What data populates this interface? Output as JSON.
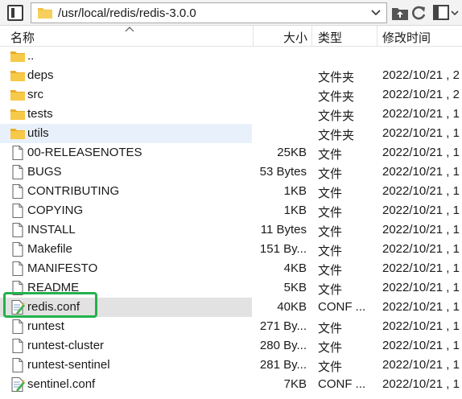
{
  "path": "/usr/local/redis/redis-3.0.0",
  "columns": {
    "name": "名称",
    "size": "大小",
    "type": "类型",
    "modified": "修改时间"
  },
  "colors": {
    "folder": "#f5c342",
    "highlight_light": "#e8f1fb",
    "highlight_selected": "#e2e2e2",
    "annotation_box": "#22b24c"
  },
  "rows": [
    {
      "name": "..",
      "size": "",
      "type": "",
      "modified": "",
      "icon": "folder-icon"
    },
    {
      "name": "deps",
      "size": "",
      "type": "文件夹",
      "modified": "2022/10/21 , 2",
      "icon": "folder-icon"
    },
    {
      "name": "src",
      "size": "",
      "type": "文件夹",
      "modified": "2022/10/21 , 2",
      "icon": "folder-icon"
    },
    {
      "name": "tests",
      "size": "",
      "type": "文件夹",
      "modified": "2022/10/21 , 1",
      "icon": "folder-icon"
    },
    {
      "name": "utils",
      "size": "",
      "type": "文件夹",
      "modified": "2022/10/21 , 1",
      "icon": "folder-icon"
    },
    {
      "name": "00-RELEASENOTES",
      "size": "25KB",
      "type": "文件",
      "modified": "2022/10/21 , 1",
      "icon": "file-icon"
    },
    {
      "name": "BUGS",
      "size": "53 Bytes",
      "type": "文件",
      "modified": "2022/10/21 , 1",
      "icon": "file-icon"
    },
    {
      "name": "CONTRIBUTING",
      "size": "1KB",
      "type": "文件",
      "modified": "2022/10/21 , 1",
      "icon": "file-icon"
    },
    {
      "name": "COPYING",
      "size": "1KB",
      "type": "文件",
      "modified": "2022/10/21 , 1",
      "icon": "file-icon"
    },
    {
      "name": "INSTALL",
      "size": "11 Bytes",
      "type": "文件",
      "modified": "2022/10/21 , 1",
      "icon": "file-icon"
    },
    {
      "name": "Makefile",
      "size": "151 By...",
      "type": "文件",
      "modified": "2022/10/21 , 1",
      "icon": "file-icon"
    },
    {
      "name": "MANIFESTO",
      "size": "4KB",
      "type": "文件",
      "modified": "2022/10/21 , 1",
      "icon": "file-icon"
    },
    {
      "name": "README",
      "size": "5KB",
      "type": "文件",
      "modified": "2022/10/21 , 1",
      "icon": "file-icon"
    },
    {
      "name": "redis.conf",
      "size": "40KB",
      "type": "CONF ...",
      "modified": "2022/10/21 , 1",
      "icon": "conf-file-icon"
    },
    {
      "name": "runtest",
      "size": "271 By...",
      "type": "文件",
      "modified": "2022/10/21 , 1",
      "icon": "file-icon"
    },
    {
      "name": "runtest-cluster",
      "size": "280 By...",
      "type": "文件",
      "modified": "2022/10/21 , 1",
      "icon": "file-icon"
    },
    {
      "name": "runtest-sentinel",
      "size": "281 By...",
      "type": "文件",
      "modified": "2022/10/21 , 1",
      "icon": "file-icon"
    },
    {
      "name": "sentinel.conf",
      "size": "7KB",
      "type": "CONF ...",
      "modified": "2022/10/21 , 1",
      "icon": "conf-file-icon"
    }
  ]
}
